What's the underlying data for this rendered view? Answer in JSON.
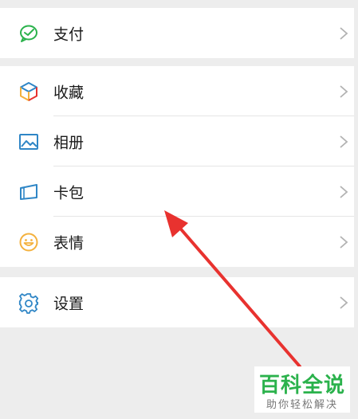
{
  "menu": {
    "pay": {
      "label": "支付",
      "icon": "wechat-pay-icon"
    },
    "favorites": {
      "label": "收藏",
      "icon": "cube-icon"
    },
    "album": {
      "label": "相册",
      "icon": "image-icon"
    },
    "cards": {
      "label": "卡包",
      "icon": "card-wallet-icon"
    },
    "stickers": {
      "label": "表情",
      "icon": "smiley-icon"
    },
    "settings": {
      "label": "设置",
      "icon": "gear-icon"
    }
  },
  "colors": {
    "background": "#ededed",
    "pay_icon": "#2bb24c",
    "blue_icon": "#2f86c6",
    "smiley_icon": "#f4b13d",
    "arrow": "#e8322f",
    "watermark_green": "#2bb24c"
  },
  "watermark": {
    "title": "百科全说",
    "subtitle": "助你轻松解决"
  }
}
